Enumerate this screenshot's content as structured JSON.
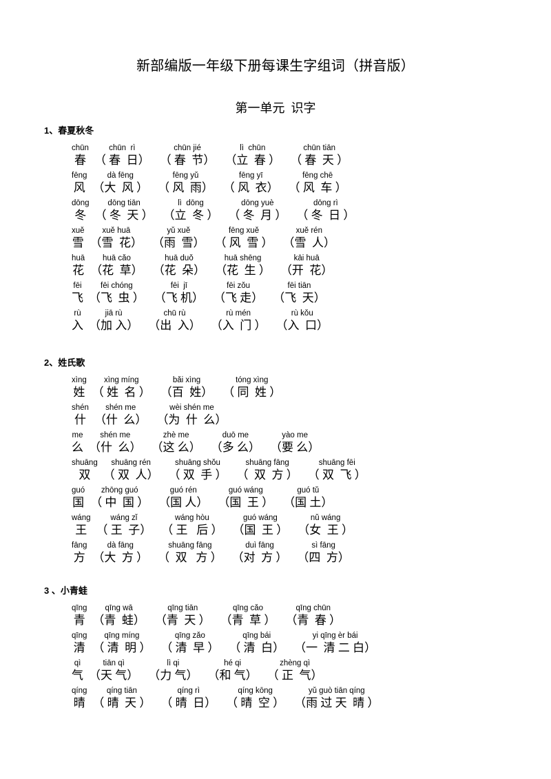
{
  "document": {
    "title": "新部编版一年级下册每课生字组词（拼音版）",
    "unit_title": "第一单元  识字"
  },
  "lessons": [
    {
      "heading": "1、春夏秋冬",
      "rows": [
        {
          "entries": [
            {
              "pinyin": "chūn",
              "hanzi": "春"
            },
            {
              "pinyin": "chūn  rì",
              "hanzi": "（ 春  日）"
            },
            {
              "pinyin": "chūn jié",
              "hanzi": "（ 春  节）"
            },
            {
              "pinyin": "lì  chūn",
              "hanzi": "（立  春 ）"
            },
            {
              "pinyin": "chūn tiān",
              "hanzi": "（ 春  天 ）"
            }
          ]
        },
        {
          "entries": [
            {
              "pinyin": "fēng",
              "hanzi": "风"
            },
            {
              "pinyin": "dà fēng",
              "hanzi": "（大  风 ）"
            },
            {
              "pinyin": "fēng yǔ",
              "hanzi": "（ 风  雨）"
            },
            {
              "pinyin": "fēng yī",
              "hanzi": "（ 风  衣）"
            },
            {
              "pinyin": "fēng chē",
              "hanzi": "（ 风  车 ）"
            }
          ]
        },
        {
          "entries": [
            {
              "pinyin": "dōng",
              "hanzi": "冬"
            },
            {
              "pinyin": "dōng tiān",
              "hanzi": "（ 冬  天 ）"
            },
            {
              "pinyin": "lì  dōng",
              "hanzi": "（立  冬 ）"
            },
            {
              "pinyin": "dōng yuè",
              "hanzi": "（ 冬  月 ）"
            },
            {
              "pinyin": "dōng rì",
              "hanzi": "（ 冬  日 ）"
            }
          ]
        },
        {
          "entries": [
            {
              "pinyin": "xuě",
              "hanzi": "雪"
            },
            {
              "pinyin": "xuě huā",
              "hanzi": "（雪  花）"
            },
            {
              "pinyin": "yǔ xuě",
              "hanzi": "（雨  雪）"
            },
            {
              "pinyin": "fēng xuě",
              "hanzi": "（ 风  雪 ）"
            },
            {
              "pinyin": "xuě rén",
              "hanzi": "（雪  人）"
            }
          ]
        },
        {
          "entries": [
            {
              "pinyin": "huā",
              "hanzi": "花"
            },
            {
              "pinyin": "huā cǎo",
              "hanzi": "（花  草）"
            },
            {
              "pinyin": "huā duǒ",
              "hanzi": "（花  朵）"
            },
            {
              "pinyin": "huā shēng",
              "hanzi": "（花  生 ）"
            },
            {
              "pinyin": "kāi huā",
              "hanzi": "（开  花）"
            }
          ]
        },
        {
          "entries": [
            {
              "pinyin": "fēi",
              "hanzi": "飞"
            },
            {
              "pinyin": "fēi chóng",
              "hanzi": "（飞  虫 ）"
            },
            {
              "pinyin": "fēi  jī",
              "hanzi": "（飞 机）"
            },
            {
              "pinyin": "fēi zǒu",
              "hanzi": "（飞 走）"
            },
            {
              "pinyin": "fēi tiān",
              "hanzi": "（飞  天）"
            }
          ]
        },
        {
          "entries": [
            {
              "pinyin": "rù",
              "hanzi": "入"
            },
            {
              "pinyin": "jiā rù",
              "hanzi": "（加 入）"
            },
            {
              "pinyin": "chū rù",
              "hanzi": "（出  入）"
            },
            {
              "pinyin": "rù mén",
              "hanzi": "（入  门 ）"
            },
            {
              "pinyin": "rù kǒu",
              "hanzi": "（入  口）"
            }
          ]
        }
      ]
    },
    {
      "heading": "2、姓氏歌",
      "rows": [
        {
          "entries": [
            {
              "pinyin": "xìng",
              "hanzi": "姓"
            },
            {
              "pinyin": "xìng míng",
              "hanzi": "（ 姓  名 ）"
            },
            {
              "pinyin": "bǎi xìng",
              "hanzi": "（百  姓）"
            },
            {
              "pinyin": "tóng xìng",
              "hanzi": "（ 同  姓 ）"
            }
          ]
        },
        {
          "entries": [
            {
              "pinyin": "shén",
              "hanzi": "什"
            },
            {
              "pinyin": "shén me",
              "hanzi": "（什  么）"
            },
            {
              "pinyin": "wèi shén me",
              "hanzi": "（为  什  么）"
            }
          ]
        },
        {
          "entries": [
            {
              "pinyin": "me",
              "hanzi": "么"
            },
            {
              "pinyin": "shén me",
              "hanzi": "（什  么）"
            },
            {
              "pinyin": "zhè me",
              "hanzi": "（这 么）"
            },
            {
              "pinyin": "duō me",
              "hanzi": "（多 么）"
            },
            {
              "pinyin": "yào me",
              "hanzi": "（要 么）"
            }
          ]
        },
        {
          "entries": [
            {
              "pinyin": "shuāng",
              "hanzi": "双"
            },
            {
              "pinyin": "shuāng rén",
              "hanzi": "（ 双  人）"
            },
            {
              "pinyin": "shuāng shǒu",
              "hanzi": "（ 双  手 ）"
            },
            {
              "pinyin": "shuāng fāng",
              "hanzi": "（  双  方 ）"
            },
            {
              "pinyin": "shuāng fēi",
              "hanzi": "（ 双  飞 ）"
            }
          ]
        },
        {
          "entries": [
            {
              "pinyin": "guó",
              "hanzi": "国"
            },
            {
              "pinyin": "zhōng guó",
              "hanzi": "（ 中  国 ）"
            },
            {
              "pinyin": "guó rén",
              "hanzi": "（国 人）"
            },
            {
              "pinyin": "guó wáng",
              "hanzi": "（国  王 ）"
            },
            {
              "pinyin": "guó tǔ",
              "hanzi": "（国 土）"
            }
          ]
        },
        {
          "entries": [
            {
              "pinyin": "wáng",
              "hanzi": "王"
            },
            {
              "pinyin": "wáng zǐ",
              "hanzi": "（ 王  子）"
            },
            {
              "pinyin": "wáng hòu",
              "hanzi": "（ 王   后 ）"
            },
            {
              "pinyin": "guó wáng",
              "hanzi": "（国  王 ）"
            },
            {
              "pinyin": "nǔ wáng",
              "hanzi": "（女  王 ）"
            }
          ]
        },
        {
          "entries": [
            {
              "pinyin": "fāng",
              "hanzi": "方"
            },
            {
              "pinyin": "dà fāng",
              "hanzi": "（大  方 ）"
            },
            {
              "pinyin": "shuāng fāng",
              "hanzi": "（  双   方 ）"
            },
            {
              "pinyin": "duì fāng",
              "hanzi": "（对  方 ）"
            },
            {
              "pinyin": "sì fāng",
              "hanzi": "（四  方）"
            }
          ]
        }
      ]
    },
    {
      "heading": "3 、小青蛙",
      "rows": [
        {
          "entries": [
            {
              "pinyin": "qīng",
              "hanzi": "青"
            },
            {
              "pinyin": "qīng wā",
              "hanzi": "（青  蛙）"
            },
            {
              "pinyin": "qīng tiān",
              "hanzi": "（青  天 ）"
            },
            {
              "pinyin": "qīng cǎo",
              "hanzi": "（青  草 ）"
            },
            {
              "pinyin": "qīng chūn",
              "hanzi": "（青  春 ）"
            }
          ]
        },
        {
          "entries": [
            {
              "pinyin": "qīng",
              "hanzi": "清"
            },
            {
              "pinyin": "qīng míng",
              "hanzi": "（ 清  明 ）"
            },
            {
              "pinyin": "qīng zǎo",
              "hanzi": "（ 清  早 ）"
            },
            {
              "pinyin": "qīng bái",
              "hanzi": "（ 清  白）"
            },
            {
              "pinyin": "yi qīng èr bái",
              "hanzi": "（一  清 二 白）"
            }
          ]
        },
        {
          "entries": [
            {
              "pinyin": "qì",
              "hanzi": "气"
            },
            {
              "pinyin": "tiān qì",
              "hanzi": "（天 气）"
            },
            {
              "pinyin": "lì qi",
              "hanzi": "（力 气）"
            },
            {
              "pinyin": "hé qi",
              "hanzi": "（和 气）"
            },
            {
              "pinyin": "zhèng qì",
              "hanzi": "（ 正  气）"
            }
          ]
        },
        {
          "entries": [
            {
              "pinyin": "qíng",
              "hanzi": "晴"
            },
            {
              "pinyin": "qíng tiān",
              "hanzi": "（ 晴  天 ）"
            },
            {
              "pinyin": "qíng rì",
              "hanzi": "（ 晴  日）"
            },
            {
              "pinyin": "qíng kōng",
              "hanzi": "（ 晴  空 ）"
            },
            {
              "pinyin": "yǔ guò tiān qíng",
              "hanzi": "（雨 过 天  晴 ）"
            }
          ]
        }
      ]
    }
  ]
}
